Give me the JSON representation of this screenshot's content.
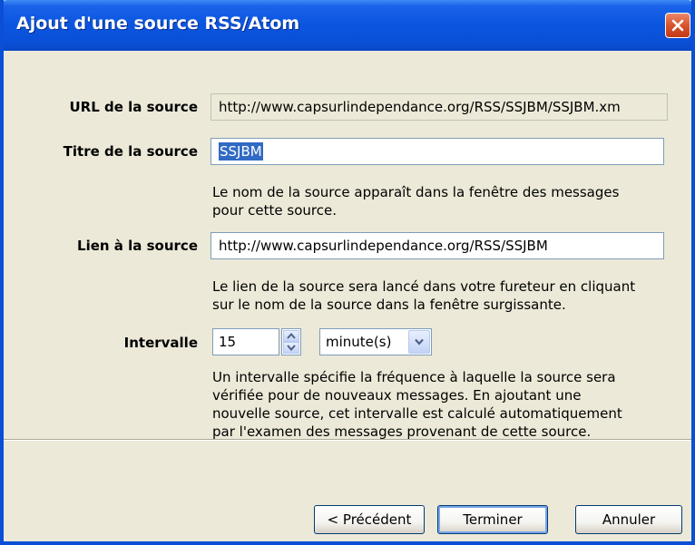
{
  "window": {
    "title": "Ajout d'une source RSS/Atom"
  },
  "form": {
    "url_label": "URL de la source",
    "url_value": "http://www.capsurlindependance.org/RSS/SSJBM/SSJBM.xm",
    "title_label": "Titre de la source",
    "title_value": "SSJBM",
    "title_help_1": "Le nom de la source apparaît dans la fenêtre des messages",
    "title_help_2": "pour cette source.",
    "link_label": "Lien à la source",
    "link_value": "http://www.capsurlindependance.org/RSS/SSJBM",
    "link_help_1": "Le lien de la source sera lancé dans votre fureteur en cliquant",
    "link_help_2": "sur le nom de la source dans la fenêtre surgissante.",
    "interval_label": "Intervalle",
    "interval_value": "15",
    "interval_unit": "minute(s)",
    "interval_help_1": "Un intervalle spécifie la fréquence à laquelle la source sera",
    "interval_help_2": "vérifiée pour de nouveaux messages.  En ajoutant une",
    "interval_help_3": "nouvelle source, cet intervalle est calculé automatiquement",
    "interval_help_4": "par l'examen des messages provenant de cette source."
  },
  "buttons": {
    "previous": "< Précédent",
    "finish": "Terminer",
    "cancel": "Annuler"
  },
  "icons": {
    "close": "close-icon",
    "spin_up": "arrow-up-icon",
    "spin_down": "arrow-down-icon",
    "dropdown": "chevron-down-icon"
  },
  "colors": {
    "titlebar": "#0a4fd6",
    "dialog_bg": "#ece9d8",
    "selection": "#316ac5",
    "close_button": "#d9532c"
  }
}
